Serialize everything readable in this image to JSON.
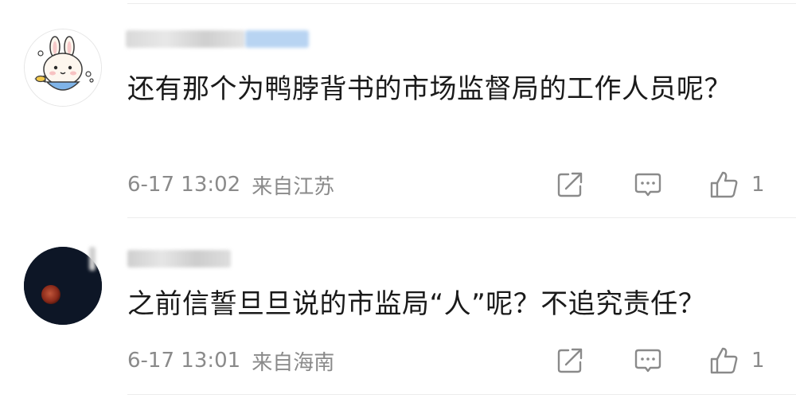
{
  "comments": [
    {
      "text": "还有那个为鸭脖背书的市场监督局的工作人员呢？",
      "time": "6-17 13:02",
      "location": "来自江苏",
      "like_count": "1",
      "avatar_icon": "cartoon-bunny-avatar",
      "username_blurred": true
    },
    {
      "text": "之前信誓旦旦说的市监局“人”呢？不追究责任？",
      "time": "6-17 13:01",
      "location": "来自海南",
      "like_count": "1",
      "avatar_icon": "blood-moon-avatar",
      "username_blurred": true
    }
  ],
  "icons": {
    "share": "share-icon",
    "comment": "comment-icon",
    "like": "thumbs-up-icon"
  },
  "colors": {
    "meta_text": "#8a8a8a",
    "body_text": "#1a1a1a",
    "divider": "#ececec",
    "username_highlight": "#b8d4f2"
  }
}
